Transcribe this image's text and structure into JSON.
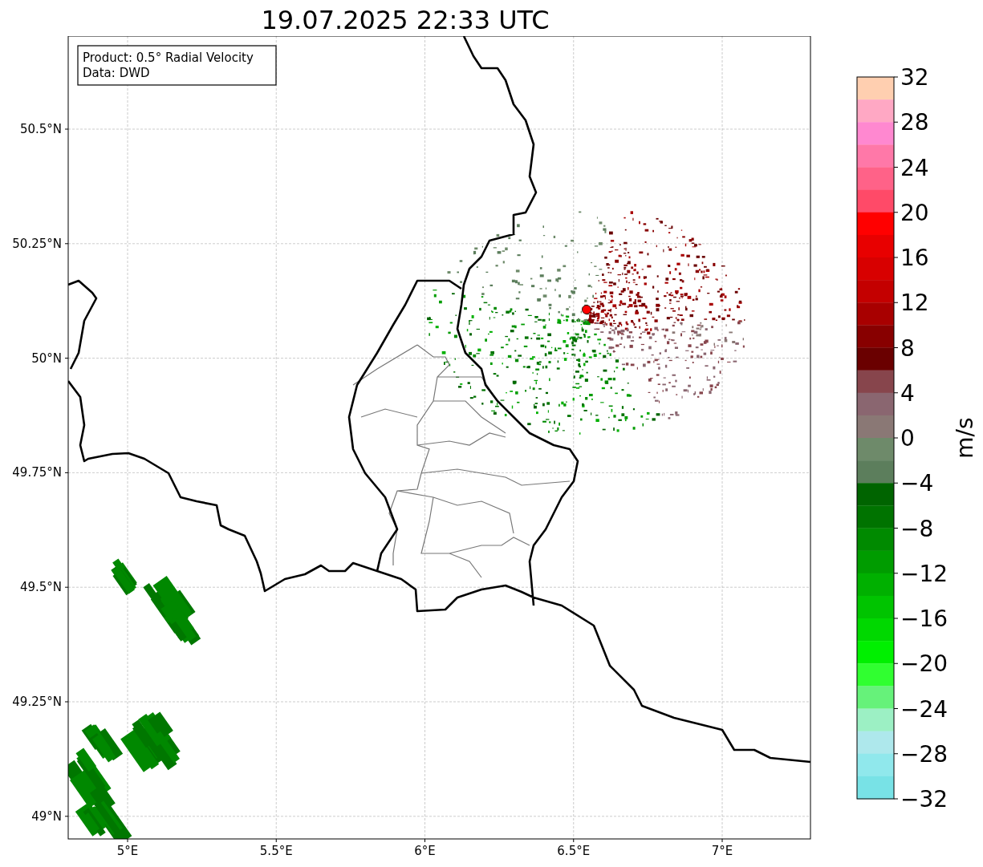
{
  "title": "19.07.2025 22:33 UTC",
  "info_box": [
    "Product: 0.5° Radial Velocity",
    "Data: DWD"
  ],
  "map": {
    "x_tick_labels": [
      "5°E",
      "5.5°E",
      "6°E",
      "6.5°E",
      "7°E"
    ],
    "y_tick_labels": [
      "50.5°N",
      "50.25°N",
      "50°N",
      "49.75°N",
      "49.5°N",
      "49.25°N",
      "49°N"
    ]
  },
  "colorbar": {
    "unit": "m/s",
    "tick_labels": [
      "32",
      "28",
      "24",
      "20",
      "16",
      "12",
      "8",
      "4",
      "0",
      "−4",
      "−8",
      "−12",
      "−16",
      "−20",
      "−24",
      "−28",
      "−32"
    ],
    "bins": [
      {
        "color": "#ffcfb0"
      },
      {
        "color": "#ffa8c4"
      },
      {
        "color": "#ff88d0"
      },
      {
        "color": "#ff78a8"
      },
      {
        "color": "#ff6288"
      },
      {
        "color": "#ff4a68"
      },
      {
        "color": "#ff0000"
      },
      {
        "color": "#e80000"
      },
      {
        "color": "#d80000"
      },
      {
        "color": "#c40000"
      },
      {
        "color": "#a80000"
      },
      {
        "color": "#880000"
      },
      {
        "color": "#6a0000"
      },
      {
        "color": "#87454c"
      },
      {
        "color": "#8a6670"
      },
      {
        "color": "#8a7875"
      },
      {
        "color": "#6e8a6a"
      },
      {
        "color": "#5c7e5c"
      },
      {
        "color": "#006400"
      },
      {
        "color": "#007300"
      },
      {
        "color": "#008a00"
      },
      {
        "color": "#009c00"
      },
      {
        "color": "#00b000"
      },
      {
        "color": "#00c400"
      },
      {
        "color": "#00d800"
      },
      {
        "color": "#00f000"
      },
      {
        "color": "#30ff30"
      },
      {
        "color": "#66f27a"
      },
      {
        "color": "#9cf0c4"
      },
      {
        "color": "#aee8ec"
      },
      {
        "color": "#90e8ec"
      },
      {
        "color": "#78e2e6"
      }
    ]
  }
}
